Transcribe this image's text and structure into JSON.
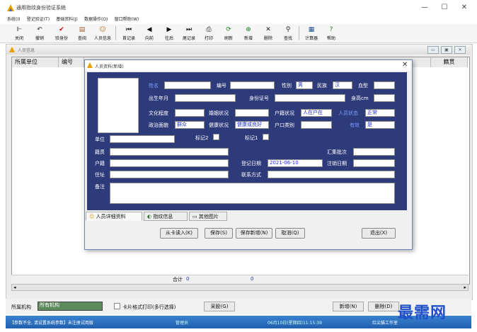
{
  "app": {
    "title": "通用指纹身份验证系统",
    "window_buttons": [
      "—",
      "☐",
      "✕"
    ]
  },
  "menu": [
    "系统(I)",
    "登记验证(T)",
    "基础资料(J)",
    "数据操作(O)",
    "窗口帮助(W)"
  ],
  "toolbar": [
    {
      "label": "关闭",
      "icon": "door-icon"
    },
    {
      "label": "撤销",
      "icon": "undo-icon"
    },
    {
      "label": "验身份",
      "icon": "check-icon"
    },
    {
      "label": "查阅",
      "icon": "book-icon"
    },
    {
      "label": "人员信息",
      "icon": "person-icon"
    },
    {
      "label": "首记录",
      "icon": "first-icon"
    },
    {
      "label": "向前",
      "icon": "prev-icon"
    },
    {
      "label": "往后",
      "icon": "next-icon"
    },
    {
      "label": "尾记录",
      "icon": "last-icon"
    },
    {
      "label": "打印",
      "icon": "print-icon"
    },
    {
      "label": "刷新",
      "icon": "refresh-icon"
    },
    {
      "label": "新增",
      "icon": "add-icon"
    },
    {
      "label": "删除",
      "icon": "delete-icon"
    },
    {
      "label": "查找",
      "icon": "find-icon"
    },
    {
      "label": "计算器",
      "icon": "calculator-icon"
    },
    {
      "label": "帮助",
      "icon": "help-icon"
    }
  ],
  "mdi": {
    "title": "人员信息"
  },
  "grid": {
    "columns": [
      "所属单位",
      "编号",
      "籍贯"
    ],
    "total_label": "合计",
    "total_count": "0",
    "total_value": "0"
  },
  "dialog": {
    "title": "人员资料(新增)",
    "close": "✕",
    "labels": {
      "name": "姓名",
      "number": "编号",
      "gender": "性别",
      "ethnicity": "民族",
      "blood": "血型",
      "birth": "出生年月",
      "idcard": "身份证号",
      "height": "身高cm",
      "education": "文化程度",
      "marital": "婚姻状况",
      "household_status": "户籍状况",
      "person_status": "人员状态",
      "political": "政治面貌",
      "health": "健康状况",
      "household_type": "户口类别",
      "valid": "有效",
      "unit": "单位",
      "mark2": "标记2",
      "mark1": "标记1",
      "native": "籍贯",
      "batch": "汇集批次",
      "household": "户籍",
      "reg_date": "登记日期",
      "cancel_date": "注销日期",
      "address": "住址",
      "contact": "联系方式",
      "remark": "备注"
    },
    "values": {
      "gender": "男",
      "ethnicity": "汉",
      "household_status": "人在户在",
      "person_status": "正常",
      "political": "群众",
      "health": "健康或良好",
      "valid": "是",
      "reg_date": "2021-06-10"
    },
    "tabs": [
      "人员详细资料",
      "指纹信息",
      "其他图片"
    ],
    "buttons": [
      "从卡读入(K)",
      "保存(S)",
      "保存新增(N)",
      "取消(Q)",
      "退出(X)"
    ]
  },
  "bottom": {
    "org_label": "所属机构",
    "org_value": "所有机构",
    "card_print": "卡片格式打印(多行选择)",
    "collect": "采股(G)",
    "add": "新增(N)",
    "delete": "删除(D)"
  },
  "status": {
    "left": "【参数不全, 请设置系统参数】未注册试用版",
    "user": "管理员",
    "datetime": "06月10日(星期四)11:15:39",
    "studio": "红尖猫工作室"
  },
  "watermark": "最需网",
  "colors": {
    "panel": "#2e3b7a",
    "accent": "#7f9bff",
    "field_text": "#2030d0",
    "taskbar": "#2a6fc0"
  }
}
